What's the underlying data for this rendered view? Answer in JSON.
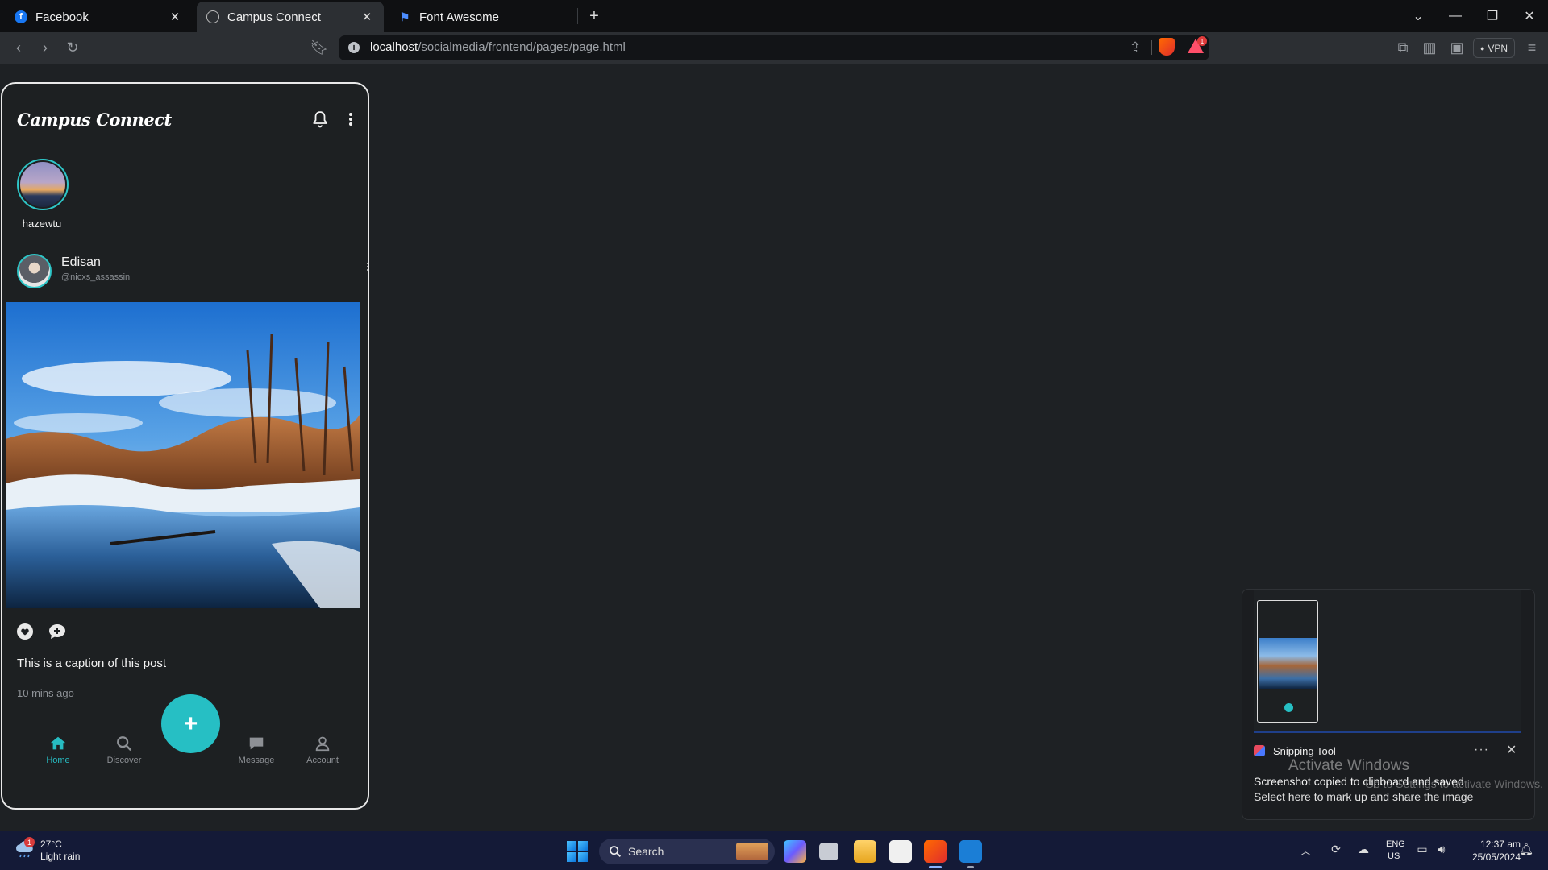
{
  "browser": {
    "tabs": [
      {
        "label": "Facebook",
        "icon": "facebook-icon",
        "active": false
      },
      {
        "label": "Campus Connect",
        "icon": "globe-icon",
        "active": true
      },
      {
        "label": "Font Awesome",
        "icon": "flag-icon",
        "active": false
      }
    ],
    "new_tab": "+",
    "url_host": "localhost",
    "url_path": "/socialmedia/frontend/pages/page.html",
    "vpn_label": "VPN",
    "shield_badge": "1"
  },
  "app": {
    "brand": "Campus Connect",
    "story": {
      "username": "hazewtu"
    },
    "post": {
      "author": "Edisan",
      "handle": "@nicxs_assassin",
      "caption": "This is a caption of this post",
      "time_ago": "10 mins ago"
    },
    "fab_label": "+",
    "bottom_nav": [
      {
        "label": "Home",
        "active": true
      },
      {
        "label": "Discover",
        "active": false
      },
      {
        "label": "Message",
        "active": false
      },
      {
        "label": "Account",
        "active": false
      }
    ],
    "accent": "#26bfc4"
  },
  "toast": {
    "app": "Snipping Tool",
    "title": "Screenshot copied to clipboard and saved",
    "body": "Select here to mark up and share the image",
    "watermark_title": "Activate Windows",
    "watermark_sub": "Go to Settings to activate Windows."
  },
  "taskbar": {
    "weather_temp": "27°C",
    "weather_desc": "Light rain",
    "weather_badge": "1",
    "search_label": "Search",
    "lang_1": "ENG",
    "lang_2": "US",
    "time": "12:37 am",
    "date": "25/05/2024"
  }
}
